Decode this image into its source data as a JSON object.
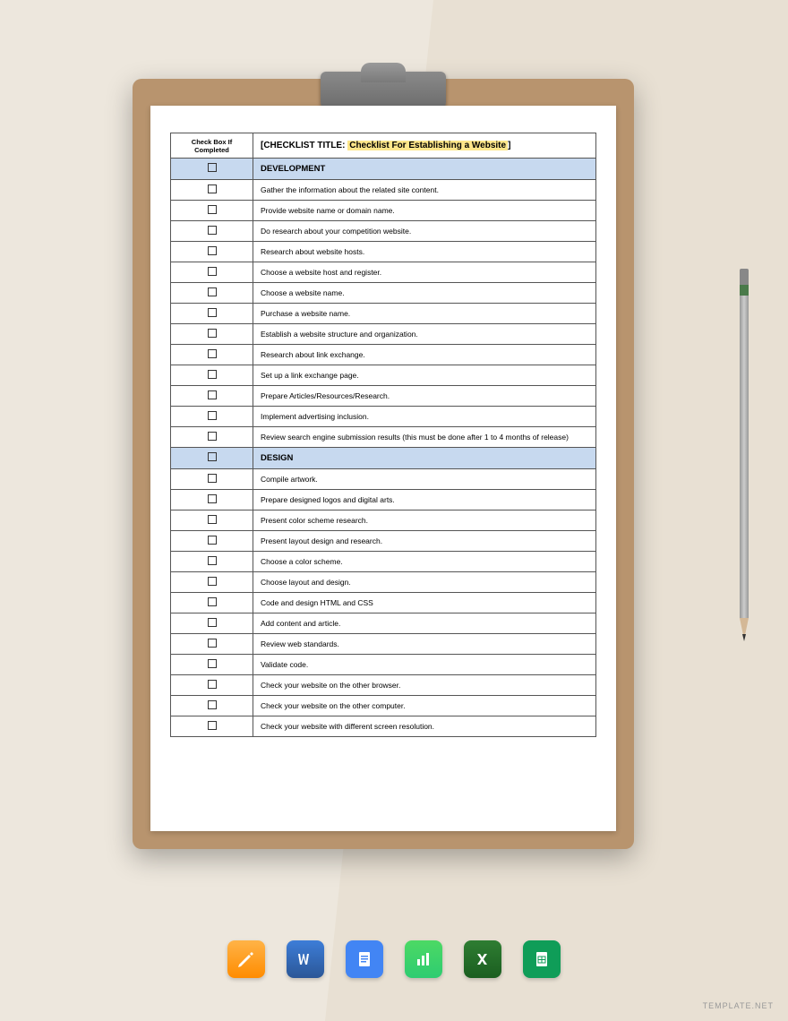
{
  "header": {
    "col1": "Check Box If\nCompleted",
    "title_prefix": "[CHECKLIST TITLE: ",
    "title_highlight": "Checklist For Establishing a Website",
    "title_suffix": "]"
  },
  "sections": [
    {
      "name": "DEVELOPMENT",
      "items": [
        "Gather the information about the related site content.",
        "Provide website name or domain name.",
        "Do research about your competition website.",
        "Research about website hosts.",
        "Choose a website host and register.",
        "Choose a website name.",
        "Purchase a website name.",
        "Establish a website structure and organization.",
        "Research about link exchange.",
        "Set up a link exchange page.",
        "Prepare Articles/Resources/Research.",
        "Implement advertising inclusion.",
        "Review search engine submission results (this must be done after 1 to 4 months of release)"
      ]
    },
    {
      "name": "DESIGN",
      "items": [
        "Compile artwork.",
        "Prepare designed logos and digital arts.",
        "Present color scheme research.",
        "Present layout design and research.",
        "Choose a color scheme.",
        "Choose layout and design.",
        "Code and design HTML and CSS",
        "Add content and article.",
        "Review web standards.",
        "Validate code.",
        "Check your website on the other browser.",
        "Check your website on the other computer.",
        "Check your website with different screen resolution."
      ]
    }
  ],
  "apps": [
    "pages",
    "word",
    "docs",
    "numbers",
    "excel",
    "sheets"
  ],
  "watermark": "TEMPLATE.NET"
}
